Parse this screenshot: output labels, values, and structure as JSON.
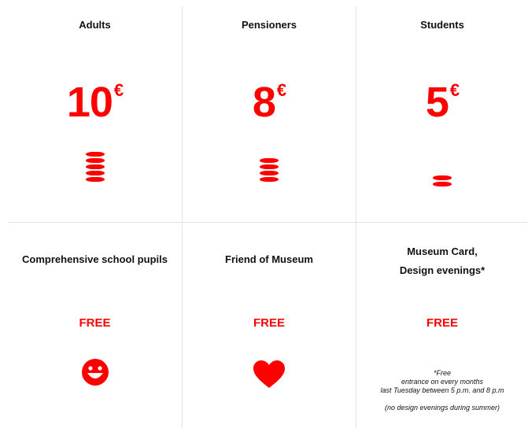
{
  "prices": [
    {
      "title": "Adults",
      "amount": "10",
      "currency": "€",
      "coins": 5
    },
    {
      "title": "Pensioners",
      "amount": "8",
      "currency": "€",
      "coins": 4
    },
    {
      "title": "Students",
      "amount": "5",
      "currency": "€",
      "coins": 2
    }
  ],
  "free_categories": [
    {
      "title_line1": "Comprehensive school pupils",
      "price": "FREE",
      "icon": "smiley-icon"
    },
    {
      "title_line1": "Friend of Museum",
      "price": "FREE",
      "icon": "heart-icon"
    },
    {
      "title_line1": "Museum Card,",
      "title_line2": "Design evenings*",
      "price": "FREE"
    }
  ],
  "footnote": {
    "line1": "*Free",
    "line2": "entrance on every months",
    "line3": "last Tuesday between 5 p.m. and 8 p.m",
    "line4": "(no design evenings during summer)"
  },
  "colors": {
    "accent": "#ff0000",
    "divider": "#e3e3e3",
    "text": "#111111"
  }
}
